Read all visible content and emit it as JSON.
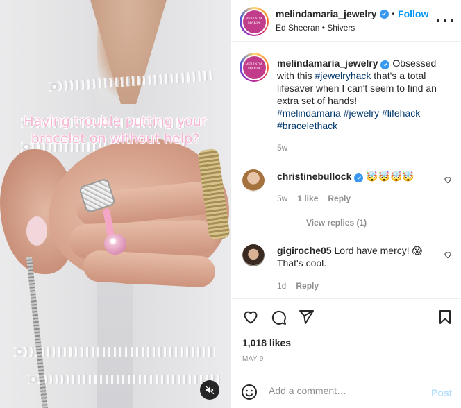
{
  "media": {
    "overlay_text": "Having trouble putting your bracelet on without help?",
    "mute_icon": "speaker-muted-icon"
  },
  "header": {
    "avatar_logo_line1": "MELINDA",
    "avatar_logo_line2": "MARIA",
    "username": "melindamaria_jewelry",
    "separator": "•",
    "follow_label": "Follow",
    "audio_artist": "Ed Sheeran",
    "audio_separator": "•",
    "audio_track": "Shivers"
  },
  "caption": {
    "username": "melindamaria_jewelry",
    "text_1": "Obsessed with this ",
    "tag_1": "#jewelryhack",
    "text_2": " that's a total lifesaver when I can't seem to find an extra set of hands!",
    "tag_2": "#melindamaria",
    "tag_3": "#jewelry",
    "tag_4": "#lifehack",
    "tag_5": "#bracelethack",
    "age": "5w"
  },
  "comments": [
    {
      "username": "christinebullock",
      "text": "🤯🤯🤯🤯",
      "age": "5w",
      "likes": "1 like",
      "reply": "Reply",
      "view_replies": "View replies (1)"
    },
    {
      "username": "gigiroche05",
      "text": "Lord have mercy! 😱 That's cool.",
      "age": "1d",
      "reply": "Reply"
    }
  ],
  "likes": "1,018 likes",
  "date": "MAY 9",
  "add_comment": {
    "placeholder": "Add a comment…",
    "post_label": "Post"
  },
  "colors": {
    "link_blue": "#0095f6",
    "hashtag": "#00376b",
    "muted": "#8e8e8e",
    "overlay_pink": "#f7b6d5"
  }
}
